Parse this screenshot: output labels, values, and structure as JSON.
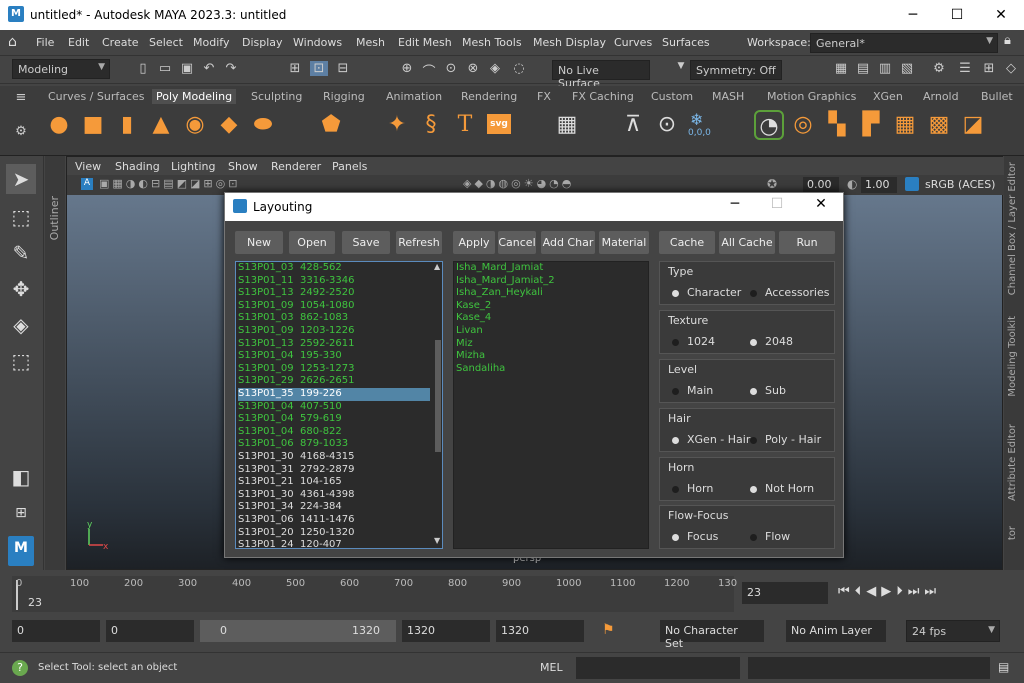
{
  "window": {
    "title": "untitled* - Autodesk MAYA 2023.3: untitled",
    "minimize": "─",
    "maximize": "☐",
    "close": "✕"
  },
  "menubar": {
    "items": [
      "File",
      "Edit",
      "Create",
      "Select",
      "Modify",
      "Display",
      "Windows",
      "Mesh",
      "Edit Mesh",
      "Mesh Tools",
      "Mesh Display",
      "Curves",
      "Surfaces"
    ],
    "workspace_label": "Workspace:",
    "workspace_value": "General*"
  },
  "statusline": {
    "menu_set": "Modeling",
    "live_surface": "No Live Surface",
    "symmetry": "Symmetry: Off"
  },
  "shelf": {
    "tabs": [
      "Curves / Surfaces",
      "Poly Modeling",
      "Sculpting",
      "Rigging",
      "Animation",
      "Rendering",
      "FX",
      "FX Caching",
      "Custom",
      "MASH",
      "Motion Graphics",
      "XGen",
      "Arnold",
      "Bullet"
    ],
    "active_tab": "Poly Modeling",
    "svg_label": "svg",
    "coords_label": "0,0,0"
  },
  "outliner": {
    "label": "Outliner"
  },
  "panel": {
    "menus": [
      "View",
      "Shading",
      "Lighting",
      "Show",
      "Renderer",
      "Panels"
    ],
    "field1": "0.00",
    "field2": "1.00",
    "colorspace": "sRGB (ACES)",
    "camera": "persp"
  },
  "rightbar": {
    "labels": [
      "Channel Box / Layer Editor",
      "Modeling Toolkit",
      "Attribute Editor",
      "tor"
    ]
  },
  "dialog": {
    "title": "Layouting",
    "buttons": [
      "New",
      "Open",
      "Save",
      "Refresh",
      "Apply",
      "Cancel",
      "Add Char",
      "Material",
      "Cache",
      "All Cache",
      "Run"
    ],
    "scenes": [
      [
        "S13P01_03",
        "428-562",
        true
      ],
      [
        "S13P01_11",
        "3316-3346",
        true
      ],
      [
        "S13P01_13",
        "2492-2520",
        true
      ],
      [
        "S13P01_09",
        "1054-1080",
        true
      ],
      [
        "S13P01_03",
        "862-1083",
        true
      ],
      [
        "S13P01_09",
        "1203-1226",
        true
      ],
      [
        "S13P01_13",
        "2592-2611",
        true
      ],
      [
        "S13P01_04",
        "195-330",
        true
      ],
      [
        "S13P01_09",
        "1253-1273",
        true
      ],
      [
        "S13P01_29",
        "2626-2651",
        true
      ],
      [
        "S13P01_35",
        "199-226",
        true
      ],
      [
        "S13P01_04",
        "407-510",
        true
      ],
      [
        "S13P01_04",
        "579-619",
        true
      ],
      [
        "S13P01_04",
        "680-822",
        true
      ],
      [
        "S13P01_06",
        "879-1033",
        true
      ],
      [
        "S13P01_30",
        "4168-4315",
        false
      ],
      [
        "S13P01_31",
        "2792-2879",
        false
      ],
      [
        "S13P01_21",
        "104-165",
        false
      ],
      [
        "S13P01_30",
        "4361-4398",
        false
      ],
      [
        "S13P01_34",
        "224-384",
        false
      ],
      [
        "S13P01_06",
        "1411-1476",
        false
      ],
      [
        "S13P01_20",
        "1250-1320",
        false
      ],
      [
        "S13P01_24",
        "120-407",
        false
      ]
    ],
    "selected_index": 10,
    "characters": [
      "Isha_Mard_Jamiat",
      "Isha_Mard_Jamiat_2",
      "Isha_Zan_Heykali",
      "Kase_2",
      "Kase_4",
      "Livan",
      "Miz",
      "Mizha",
      "Sandaliha"
    ],
    "groups": [
      {
        "title": "Type",
        "options": [
          "Character",
          "Accessories"
        ],
        "selected": 0
      },
      {
        "title": "Texture",
        "options": [
          "1024",
          "2048"
        ],
        "selected": 1
      },
      {
        "title": "Level",
        "options": [
          "Main",
          "Sub"
        ],
        "selected": 1
      },
      {
        "title": "Hair",
        "options": [
          "XGen - Hair",
          "Poly - Hair"
        ],
        "selected": 0
      },
      {
        "title": "Horn",
        "options": [
          "Horn",
          "Not Horn"
        ],
        "selected": 1
      },
      {
        "title": "Flow-Focus",
        "options": [
          "Focus",
          "Flow"
        ],
        "selected": 0
      }
    ]
  },
  "timeline": {
    "ticks": [
      "0",
      "100",
      "200",
      "300",
      "400",
      "500",
      "600",
      "700",
      "800",
      "900",
      "1000",
      "1100",
      "1200",
      "130"
    ],
    "current": "23",
    "current_field": "23"
  },
  "range": {
    "start": "0",
    "anim_start": "0",
    "slider_start": "0",
    "slider_end": "1320",
    "anim_end": "1320",
    "end": "1320",
    "character_set": "No Character Set",
    "anim_layer": "No Anim Layer",
    "fps": "24 fps"
  },
  "help": {
    "text": "Select Tool: select an object",
    "lang": "MEL"
  },
  "colors": {
    "green_text": "#3fc43f",
    "selection": "#5285a6",
    "shelf_icon": "#f59a3a"
  }
}
